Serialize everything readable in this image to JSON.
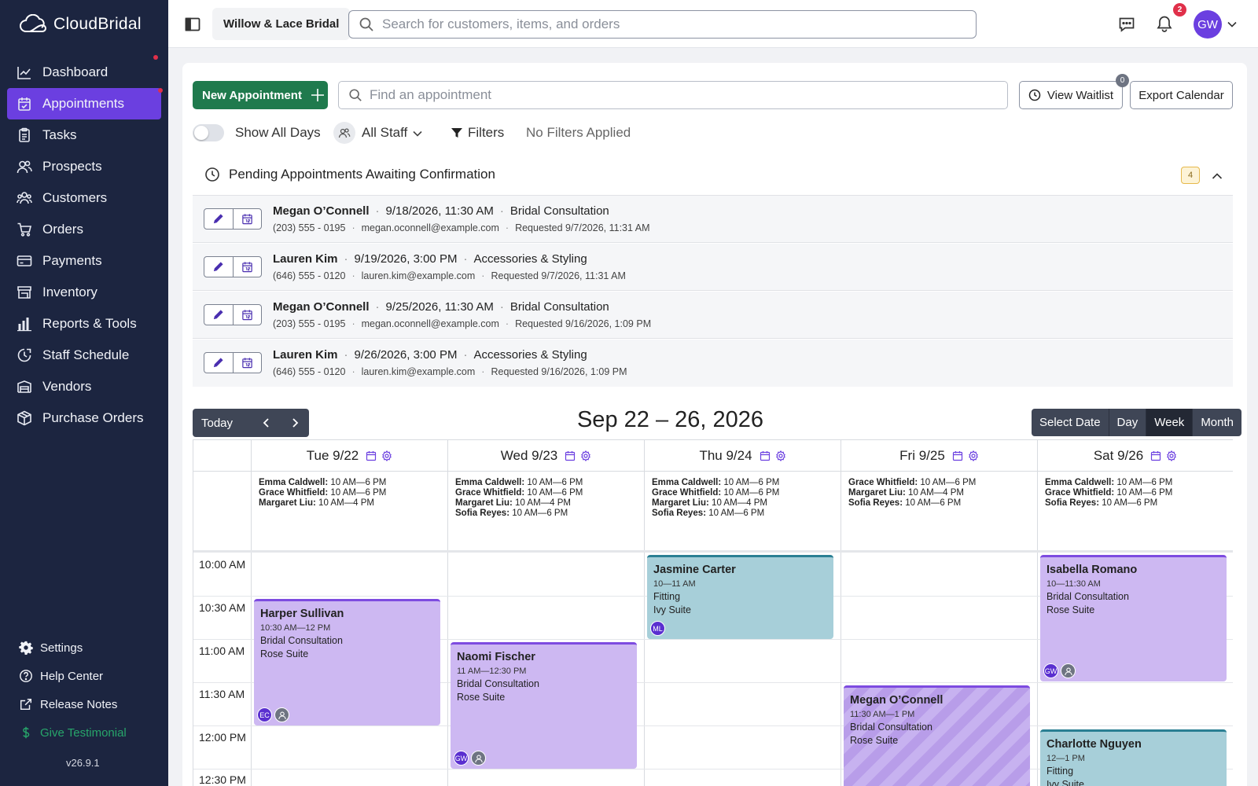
{
  "brand": {
    "name": "CloudBridal"
  },
  "sidebar": {
    "items": [
      {
        "label": "Dashboard",
        "icon": "chart-line-icon"
      },
      {
        "label": "Appointments",
        "icon": "calendar-check-icon"
      },
      {
        "label": "Tasks",
        "icon": "clipboard-icon"
      },
      {
        "label": "Prospects",
        "icon": "users-icon"
      },
      {
        "label": "Customers",
        "icon": "user-group-icon"
      },
      {
        "label": "Orders",
        "icon": "cart-icon"
      },
      {
        "label": "Payments",
        "icon": "payment-card-icon"
      },
      {
        "label": "Inventory",
        "icon": "storefront-icon"
      },
      {
        "label": "Reports & Tools",
        "icon": "bar-chart-icon"
      },
      {
        "label": "Staff Schedule",
        "icon": "clock-icon"
      },
      {
        "label": "Vendors",
        "icon": "truck-icon"
      },
      {
        "label": "Purchase Orders",
        "icon": "box-icon"
      }
    ],
    "active": "Appointments",
    "bottom": [
      {
        "label": "Settings",
        "icon": "gear-icon"
      },
      {
        "label": "Help Center",
        "icon": "help-circle-icon"
      },
      {
        "label": "Release Notes",
        "icon": "external-link-icon"
      },
      {
        "label": "Give Testimonial",
        "icon": "dollar-icon"
      }
    ],
    "version": "v26.9.1"
  },
  "topbar": {
    "store": "Willow & Lace Bridal",
    "search_placeholder": "Search for customers, items, and orders",
    "notification_count": "2",
    "user_initials": "GW"
  },
  "toolbar": {
    "new_appointment": "New Appointment",
    "find_placeholder": "Find an appointment",
    "view_waitlist": "View Waitlist",
    "waitlist_count": "0",
    "export_calendar": "Export Calendar",
    "show_all_days": "Show All Days",
    "all_staff": "All Staff",
    "filters": "Filters",
    "no_filters": "No Filters Applied"
  },
  "pending": {
    "title": "Pending Appointments Awaiting Confirmation",
    "count": "4",
    "rows": [
      {
        "name": "Megan O’Connell",
        "datetime": "9/18/2026, 11:30 AM",
        "type": "Bridal Consultation",
        "phone": "(203) 555 - 0195",
        "email": "megan.oconnell@example.com",
        "requested": "Requested 9/7/2026, 11:31 AM"
      },
      {
        "name": "Lauren Kim",
        "datetime": "9/19/2026, 3:00 PM",
        "type": "Accessories & Styling",
        "phone": "(646) 555 - 0120",
        "email": "lauren.kim@example.com",
        "requested": "Requested 9/7/2026, 11:31 AM"
      },
      {
        "name": "Megan O’Connell",
        "datetime": "9/25/2026, 11:30 AM",
        "type": "Bridal Consultation",
        "phone": "(203) 555 - 0195",
        "email": "megan.oconnell@example.com",
        "requested": "Requested 9/16/2026, 1:09 PM"
      },
      {
        "name": "Lauren Kim",
        "datetime": "9/26/2026, 3:00 PM",
        "type": "Accessories & Styling",
        "phone": "(646) 555 - 0120",
        "email": "lauren.kim@example.com",
        "requested": "Requested 9/16/2026, 1:09 PM"
      }
    ]
  },
  "calendar": {
    "today": "Today",
    "title": "Sep 22 – 26, 2026",
    "views": [
      "Select Date",
      "Day",
      "Week",
      "Month"
    ],
    "selected_view": "Week",
    "times": [
      "10:00 AM",
      "10:30 AM",
      "11:00 AM",
      "11:30 AM",
      "12:00 PM",
      "12:30 PM"
    ],
    "days": [
      {
        "label": "Tue 9/22",
        "staff": [
          {
            "name": "Emma Caldwell:",
            "hours": "10 AM—6 PM"
          },
          {
            "name": "Grace Whitfield:",
            "hours": "10 AM—6 PM"
          },
          {
            "name": "Margaret Liu:",
            "hours": "10 AM—4 PM"
          }
        ]
      },
      {
        "label": "Wed 9/23",
        "staff": [
          {
            "name": "Emma Caldwell:",
            "hours": "10 AM—6 PM"
          },
          {
            "name": "Grace Whitfield:",
            "hours": "10 AM—6 PM"
          },
          {
            "name": "Margaret Liu:",
            "hours": "10 AM—4 PM"
          },
          {
            "name": "Sofia Reyes:",
            "hours": "10 AM—6 PM"
          }
        ]
      },
      {
        "label": "Thu 9/24",
        "staff": [
          {
            "name": "Emma Caldwell:",
            "hours": "10 AM—6 PM"
          },
          {
            "name": "Grace Whitfield:",
            "hours": "10 AM—6 PM"
          },
          {
            "name": "Margaret Liu:",
            "hours": "10 AM—4 PM"
          },
          {
            "name": "Sofia Reyes:",
            "hours": "10 AM—6 PM"
          }
        ]
      },
      {
        "label": "Fri 9/25",
        "staff": [
          {
            "name": "Grace Whitfield:",
            "hours": "10 AM—6 PM"
          },
          {
            "name": "Margaret Liu:",
            "hours": "10 AM—4 PM"
          },
          {
            "name": "Sofia Reyes:",
            "hours": "10 AM—6 PM"
          }
        ]
      },
      {
        "label": "Sat 9/26",
        "staff": [
          {
            "name": "Emma Caldwell:",
            "hours": "10 AM—6 PM"
          },
          {
            "name": "Grace Whitfield:",
            "hours": "10 AM—6 PM"
          },
          {
            "name": "Sofia Reyes:",
            "hours": "10 AM—6 PM"
          }
        ]
      }
    ],
    "events": [
      {
        "name": "Harper Sullivan",
        "time": "10:30 AM—12 PM",
        "type": "Bridal Consultation",
        "room": "Rose Suite",
        "initials": "EC"
      },
      {
        "name": "Naomi Fischer",
        "time": "11 AM—12:30 PM",
        "type": "Bridal Consultation",
        "room": "Rose Suite",
        "initials": "GW"
      },
      {
        "name": "Jasmine Carter",
        "time": "10—11 AM",
        "type": "Fitting",
        "room": "Ivy Suite",
        "initials": "ML"
      },
      {
        "name": "Megan O’Connell",
        "time": "11:30 AM—1 PM",
        "type": "Bridal Consultation",
        "room": "Rose Suite"
      },
      {
        "name": "Isabella Romano",
        "time": "10—11:30 AM",
        "type": "Bridal Consultation",
        "room": "Rose Suite",
        "initials": "GW"
      },
      {
        "name": "Charlotte Nguyen",
        "time": "12—1 PM",
        "type": "Fitting",
        "room": "Ivy Suite"
      }
    ]
  }
}
